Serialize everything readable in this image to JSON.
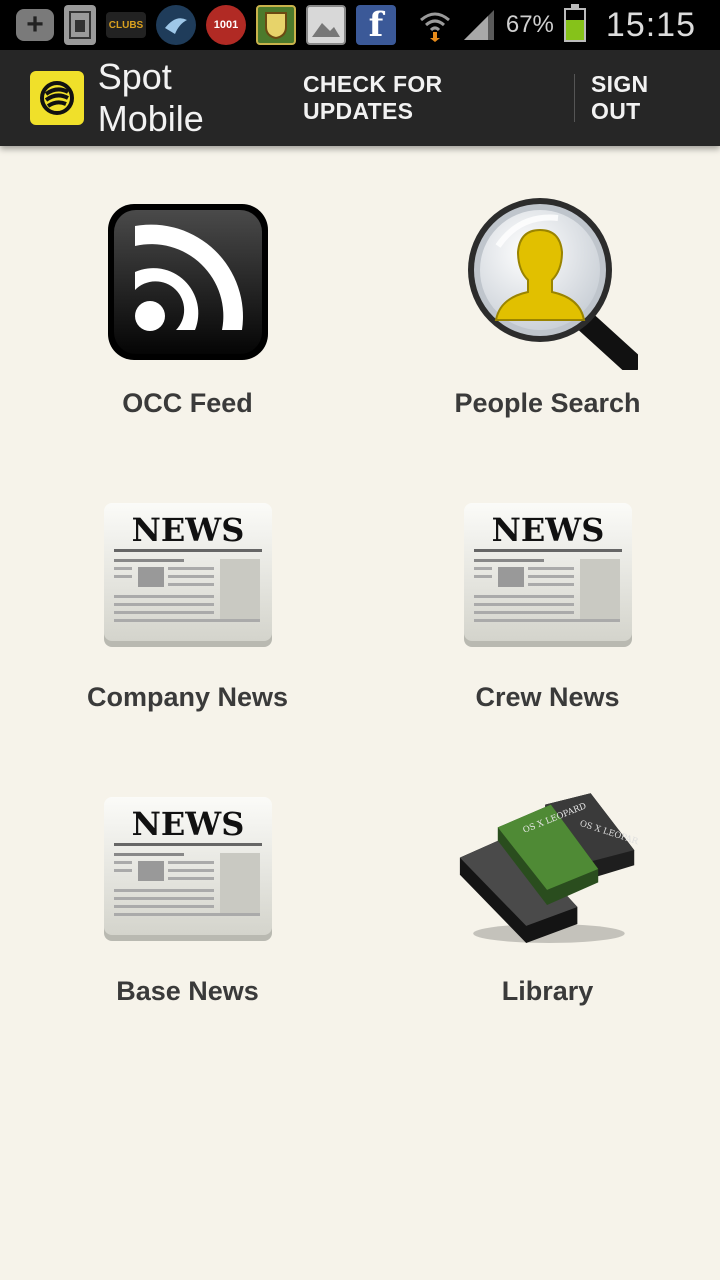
{
  "status_bar": {
    "notifications": [
      {
        "icon": "add-icon",
        "text": "+"
      },
      {
        "icon": "sim-card-icon",
        "text": ""
      },
      {
        "icon": "clubs-app-icon",
        "text": "CLUBS"
      },
      {
        "icon": "bird-app-icon",
        "text": ""
      },
      {
        "icon": "1001-app-icon",
        "text": "1001"
      },
      {
        "icon": "crest-app-icon",
        "text": ""
      },
      {
        "icon": "gallery-icon",
        "text": ""
      },
      {
        "icon": "facebook-icon",
        "text": "f"
      }
    ],
    "battery_percent": "67%",
    "battery_level": 0.67,
    "time": "15:15"
  },
  "action_bar": {
    "title": "Spot Mobile",
    "check_updates": "CHECK FOR UPDATES",
    "sign_out": "SIGN OUT"
  },
  "tiles": [
    {
      "label": "OCC Feed",
      "icon": "rss-feed-icon"
    },
    {
      "label": "People Search",
      "icon": "people-search-icon"
    },
    {
      "label": "Company News",
      "icon": "newspaper-icon",
      "headline": "NEWS"
    },
    {
      "label": "Crew News",
      "icon": "newspaper-icon",
      "headline": "NEWS"
    },
    {
      "label": "Base News",
      "icon": "newspaper-icon",
      "headline": "NEWS"
    },
    {
      "label": "Library",
      "icon": "books-icon",
      "book_text": "OS X LEOPARD"
    }
  ],
  "colors": {
    "background": "#f6f3ea",
    "action_bar": "#262626",
    "logo_yellow": "#f0e02a",
    "battery_green": "#86c21a"
  }
}
